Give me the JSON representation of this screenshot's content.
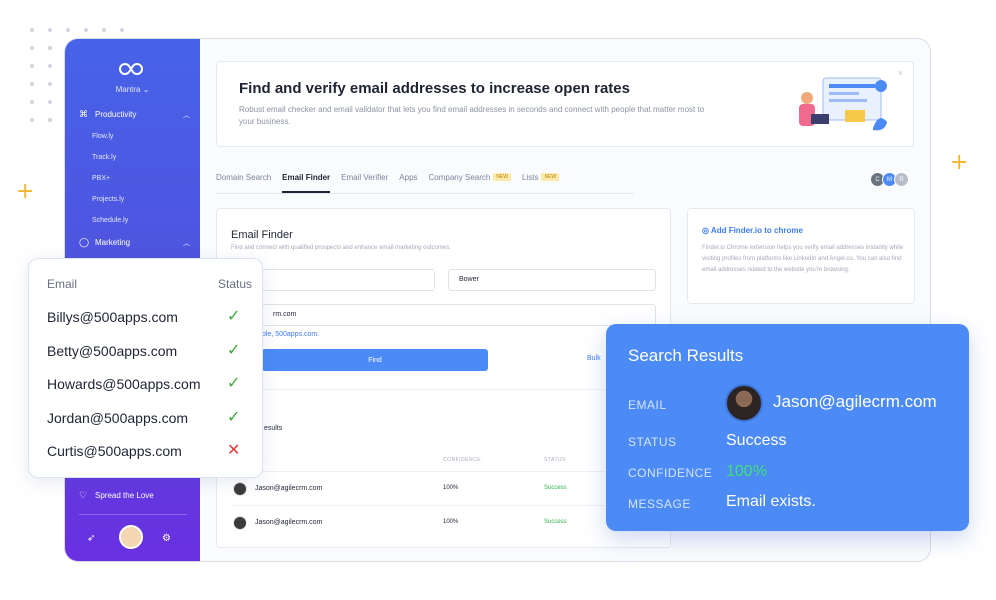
{
  "sidebar": {
    "brand": "Mantra",
    "sections": [
      {
        "label": "Productivity",
        "icon": "command-icon"
      },
      {
        "label": "Marketing",
        "icon": "circle-icon"
      }
    ],
    "apps": [
      "Flow.ly",
      "Track.ly",
      "PBX+",
      "Projects.ly",
      "Schedule.ly"
    ],
    "footer_item": "Spread the Love"
  },
  "hero": {
    "title": "Find and verify email addresses to increase open rates",
    "description": "Robust email checker and email validator that lets you find email addresses in seconds and connect with people that matter most to your business.",
    "close": "×"
  },
  "tabs": [
    {
      "label": "Domain Search"
    },
    {
      "label": "Email Finder",
      "active": true
    },
    {
      "label": "Email Verifier"
    },
    {
      "label": "Apps"
    },
    {
      "label": "Company Search",
      "badge": "NEW"
    },
    {
      "label": "Lists",
      "badge": "NEW"
    }
  ],
  "team_avatars": [
    "C",
    "M",
    "R"
  ],
  "finder": {
    "title": "Email Finder",
    "description": "Find and connect with qualified prospects and enhance email marketing outcomes.",
    "last_name": "Bower",
    "domain_value": "rm.com",
    "hint": "ple, 500apps.com.",
    "find_label": "Find",
    "bulk_label": "Bulk",
    "results_label": "esults",
    "columns": {
      "confidence": "CONFIDENCE",
      "status": "STATUS"
    },
    "rows": [
      {
        "email": "Jason@agilecrm.com",
        "confidence": "100%",
        "status": "Success"
      },
      {
        "email": "Jason@agilecrm.com",
        "confidence": "100%",
        "status": "Success"
      }
    ]
  },
  "chrome": {
    "title": "Add Finder.io to chrome",
    "body": "Finder.io Chrome extension helps you verify email addresses instantly while visiting profiles from platforms like LinkedIn and Angel.co. You can also find email addresses related to the website you're browsing."
  },
  "email_list": {
    "col_email": "Email",
    "col_status": "Status",
    "items": [
      {
        "email": "Billys@500apps.com",
        "valid": true
      },
      {
        "email": "Betty@500apps.com",
        "valid": true
      },
      {
        "email": "Howards@500apps.com",
        "valid": true
      },
      {
        "email": "Jordan@500apps.com",
        "valid": true
      },
      {
        "email": "Curtis@500apps.com",
        "valid": false
      }
    ],
    "ok_mark": "✓",
    "bad_mark": "✕"
  },
  "search_results": {
    "title": "Search Results",
    "email_label": "EMAIL",
    "email": "Jason@agilecrm.com",
    "status_label": "STATUS",
    "status": "Success",
    "confidence_label": "CONFIDENCE",
    "confidence": "100%",
    "message_label": "MESSAGE",
    "message": "Email exists."
  },
  "colors": {
    "accent": "#4c8bf5",
    "success": "#31b04a",
    "error": "#e53d3d",
    "sidebar_top": "#4763e8",
    "sidebar_bottom": "#6a2fe0"
  }
}
